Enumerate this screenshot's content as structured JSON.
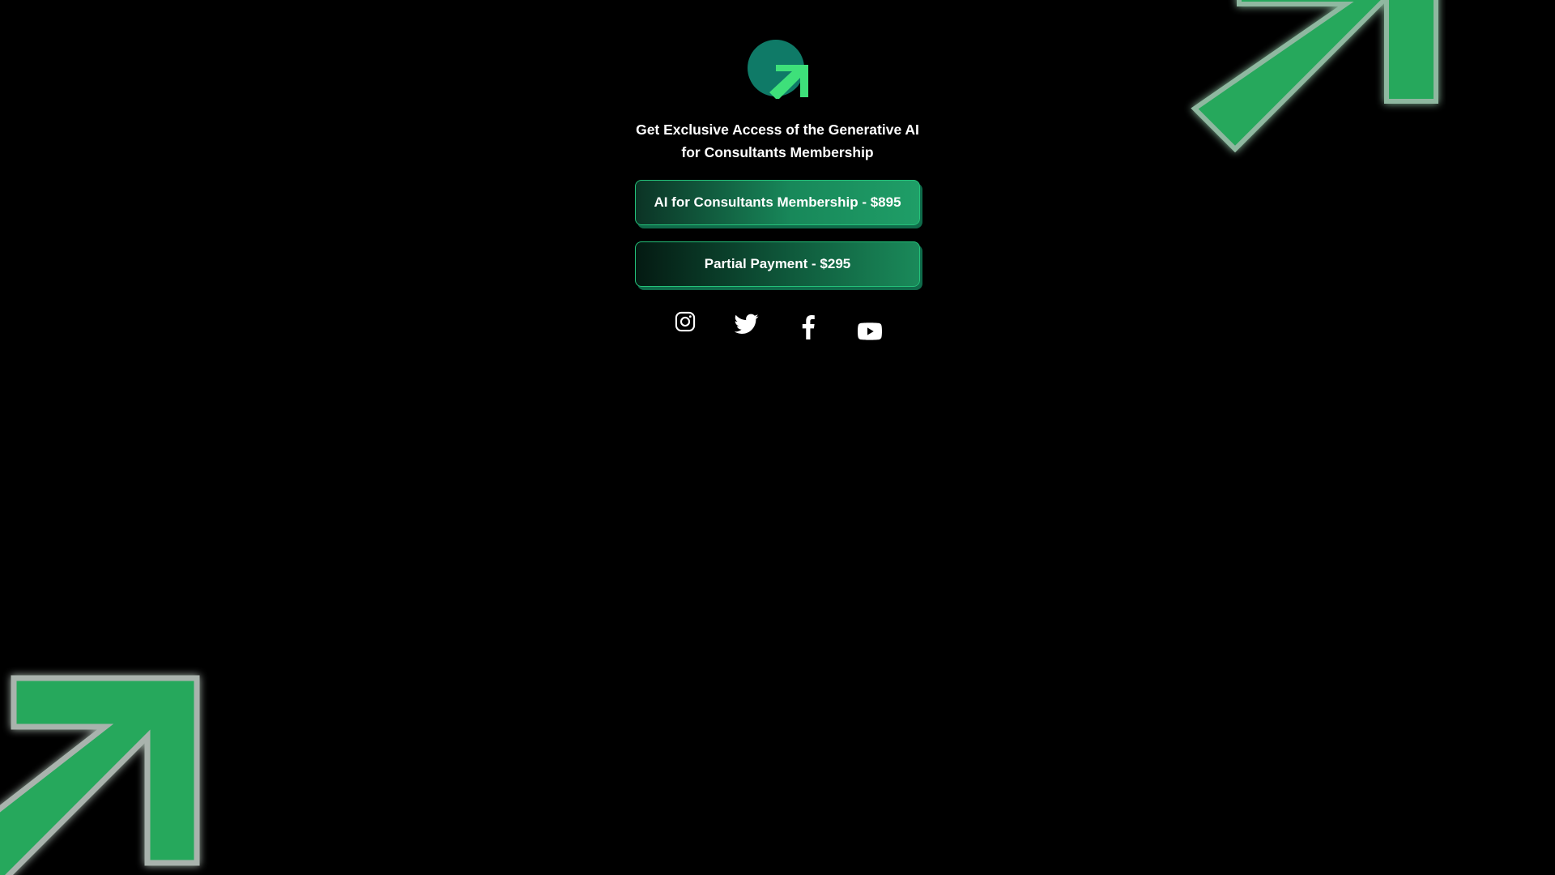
{
  "colors": {
    "background": "#000000",
    "accent_green": "#2fbf6f",
    "logo_teal": "#0f7a67",
    "logo_arrow": "#3ee07a",
    "text": "#ffffff"
  },
  "logo": {
    "icon": "brand-logo-arrow-icon"
  },
  "headline": "Get Exclusive Access of the Generative AI for Consultants Membership",
  "links": [
    {
      "label": "AI for Consultants Membership - $895"
    },
    {
      "label": "Partial Payment - $295"
    }
  ],
  "socials": [
    {
      "icon": "instagram-icon"
    },
    {
      "icon": "twitter-icon"
    },
    {
      "icon": "facebook-icon"
    },
    {
      "icon": "youtube-icon"
    }
  ]
}
